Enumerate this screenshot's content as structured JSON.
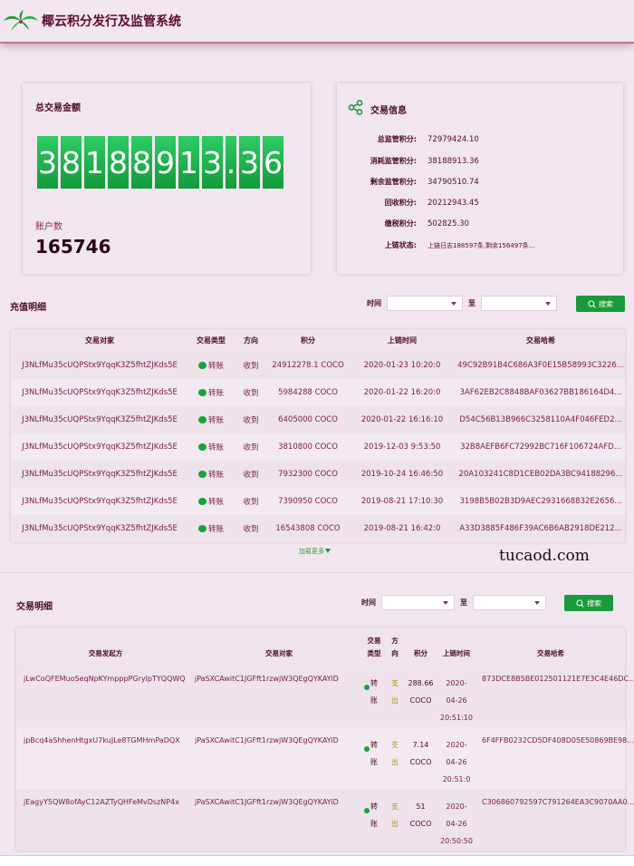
{
  "header": {
    "title": "椰云积分发行及监管系统",
    "logo": "palm-leaf-logo"
  },
  "summary": {
    "total_title": "总交易金额",
    "total_digits": [
      "3",
      "8",
      "1",
      "8",
      "8",
      "9",
      "1",
      "3",
      ".",
      "3",
      "6"
    ],
    "account_label": "账户数",
    "account_value": "165746"
  },
  "info": {
    "icon": "share-nodes-icon",
    "title": "交易信息",
    "rows": [
      {
        "label": "总监管积分:",
        "value": "72979424.10"
      },
      {
        "label": "消耗监管积分:",
        "value": "38188913.36"
      },
      {
        "label": "剩余监管积分:",
        "value": "34790510.74"
      },
      {
        "label": "回收积分:",
        "value": "20212943.45"
      },
      {
        "label": "缴税积分:",
        "value": "502825.30"
      },
      {
        "label": "上链状态:",
        "value": "上链日志188597条,剩余156497条..."
      }
    ]
  },
  "recharge": {
    "title": "充值明细",
    "filter": {
      "time_label": "时间",
      "to_label": "至",
      "start": "",
      "end": "",
      "search_label": "搜索"
    },
    "columns": [
      "交易对家",
      "交易类型",
      "方向",
      "积分",
      "上链时间",
      "交易哈希"
    ],
    "rows": [
      {
        "counterparty": "J3NLfMu35cUQPStx9YqqK3Z5fhtZJKds5E",
        "type": "转账",
        "direction": "收到",
        "amount": "24912278.1 COCO",
        "time": "2020-01-23 10:20:0",
        "hash": "49C92B91B4C686A3F0E15B58993C3226..."
      },
      {
        "counterparty": "J3NLfMu35cUQPStx9YqqK3Z5fhtZJKds5E",
        "type": "转账",
        "direction": "收到",
        "amount": "5984288 COCO",
        "time": "2020-01-22 16:20:0",
        "hash": "3AF62EB2C8848BAF03627BB186164D4..."
      },
      {
        "counterparty": "J3NLfMu35cUQPStx9YqqK3Z5fhtZJKds5E",
        "type": "转账",
        "direction": "收到",
        "amount": "6405000 COCO",
        "time": "2020-01-22 16:16:10",
        "hash": "D54C56B13B966C3258110A4F046FED2..."
      },
      {
        "counterparty": "J3NLfMu35cUQPStx9YqqK3Z5fhtZJKds5E",
        "type": "转账",
        "direction": "收到",
        "amount": "3810800 COCO",
        "time": "2019-12-03 9:53:50",
        "hash": "32B8AEFB6FC72992BC716F106724AFD..."
      },
      {
        "counterparty": "J3NLfMu35cUQPStx9YqqK3Z5fhtZJKds5E",
        "type": "转账",
        "direction": "收到",
        "amount": "7932300 COCO",
        "time": "2019-10-24 16:46:50",
        "hash": "20A103241C8D1CEB02DA3BC94188296..."
      },
      {
        "counterparty": "J3NLfMu35cUQPStx9YqqK3Z5fhtZJKds5E",
        "type": "转账",
        "direction": "收到",
        "amount": "7390950 COCO",
        "time": "2019-08-21 17:10:30",
        "hash": "3198B5B02B3D9AEC2931668832E2656..."
      },
      {
        "counterparty": "J3NLfMu35cUQPStx9YqqK3Z5fhtZJKds5E",
        "type": "转账",
        "direction": "收到",
        "amount": "16543808 COCO",
        "time": "2019-08-21 16:42:0",
        "hash": "A33D3885F486F39AC6B6AB2918DE212..."
      }
    ],
    "load_more": "加载更多"
  },
  "watermark": "tucaod.com",
  "transactions": {
    "title": "交易明细",
    "filter": {
      "time_label": "时间",
      "to_label": "至",
      "start": "",
      "end": "",
      "search_label": "搜索"
    },
    "columns": {
      "initiator": "交易发起方",
      "counterparty": "交易对家",
      "type_line1": "交易",
      "type_line2": "类型",
      "dir_line1": "方",
      "dir_line2": "向",
      "amount": "积分",
      "time": "上链时间",
      "hash": "交易哈希"
    },
    "rows": [
      {
        "initiator": "jLwCoQFEMuoSeqNpKYmpppPGryIpTYQQWQ",
        "counterparty": "jPaSXCAwitC1JGFft1rzwjW3QEgQYKAYiD",
        "type1": "转",
        "type2": "账",
        "dir1": "支",
        "dir2": "出",
        "amount1": "288.66",
        "amount2": "COCO",
        "time1": "2020-",
        "time2": "04-26",
        "time3": "20:51:10",
        "hash": "873DCE8B5BE012501121E7E3C4E46DC..."
      },
      {
        "initiator": "jpBcq4aShhenHtgxU7kuJLe8TGMHmPaDQX",
        "counterparty": "jPaSXCAwitC1JGFft1rzwjW3QEgQYKAYiD",
        "type1": "转",
        "type2": "账",
        "dir1": "支",
        "dir2": "出",
        "amount1": "7.14",
        "amount2": "COCO",
        "time1": "2020-",
        "time2": "04-26",
        "time3": "20:51:0",
        "hash": "6F4FFB0232CD5DF408D05E50869BE98..."
      },
      {
        "initiator": "jEagyY5QW8ofAyC12AZTyQHFeMvDszNP4x",
        "counterparty": "jPaSXCAwitC1JGFft1rzwjW3QEgQYKAYiD",
        "type1": "转",
        "type2": "账",
        "dir1": "支",
        "dir2": "出",
        "amount1": "51",
        "amount2": "COCO",
        "time1": "2020-",
        "time2": "04-26",
        "time3": "20:50:50",
        "hash": "C306860792597C791264EA3C9070AA0..."
      }
    ]
  }
}
